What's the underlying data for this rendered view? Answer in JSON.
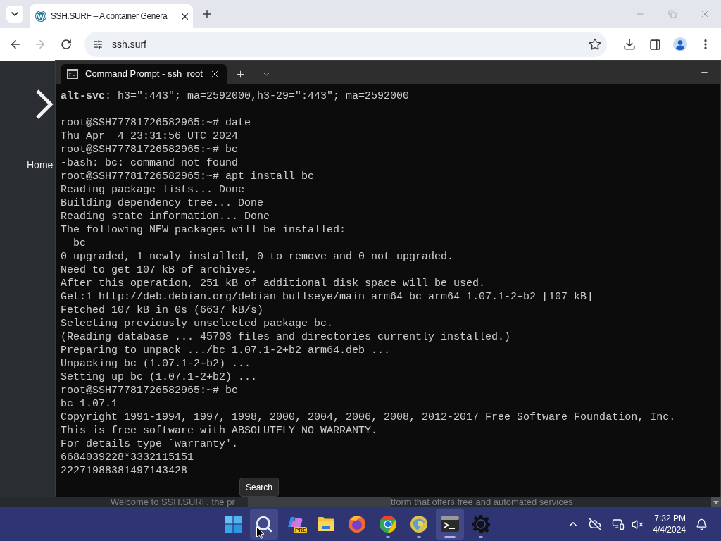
{
  "browser": {
    "tabs": [
      {
        "title": "SSH.SURF – A container Genera",
        "selected": true
      }
    ],
    "nav": {
      "back_disabled": false,
      "forward_disabled": true
    },
    "address": "ssh.surf"
  },
  "page": {
    "nav_label": "Home",
    "footer_texts": [
      "Welcome to SSH.SURF, the pr",
      "tform that offers free and automated services"
    ]
  },
  "terminal": {
    "tabs": [
      {
        "title": "Command Prompt - ssh  root",
        "selected": true
      }
    ],
    "lines": [
      {
        "kind": "output",
        "text": "**alt-svc**: h3=\":443\"; ma=2592000,h3-29=\":443\"; ma=2592000"
      },
      {
        "kind": "blank"
      },
      {
        "kind": "output",
        "text": "root@SSH77781726582965:~# date"
      },
      {
        "kind": "output",
        "text": "Thu Apr  4 23:31:56 UTC 2024"
      },
      {
        "kind": "output",
        "text": "root@SSH77781726582965:~# bc"
      },
      {
        "kind": "output",
        "text": "-bash: bc: command not found"
      },
      {
        "kind": "output",
        "text": "root@SSH77781726582965:~# apt install bc"
      },
      {
        "kind": "output",
        "text": "Reading package lists... Done"
      },
      {
        "kind": "output",
        "text": "Building dependency tree... Done"
      },
      {
        "kind": "output",
        "text": "Reading state information... Done"
      },
      {
        "kind": "output",
        "text": "The following NEW packages will be installed:"
      },
      {
        "kind": "output",
        "text": "  bc"
      },
      {
        "kind": "output",
        "text": "0 upgraded, 1 newly installed, 0 to remove and 0 not upgraded."
      },
      {
        "kind": "output",
        "text": "Need to get 107 kB of archives."
      },
      {
        "kind": "output",
        "text": "After this operation, 251 kB of additional disk space will be used."
      },
      {
        "kind": "output",
        "text": "Get:1 http://deb.debian.org/debian bullseye/main arm64 bc arm64 1.07.1-2+b2 [107 kB]"
      },
      {
        "kind": "output",
        "text": "Fetched 107 kB in 0s (6637 kB/s)"
      },
      {
        "kind": "output",
        "text": "Selecting previously unselected package bc."
      },
      {
        "kind": "output",
        "text": "(Reading database ... 45703 files and directories currently installed.)"
      },
      {
        "kind": "output",
        "text": "Preparing to unpack .../bc_1.07.1-2+b2_arm64.deb ..."
      },
      {
        "kind": "output",
        "text": "Unpacking bc (1.07.1-2+b2) ..."
      },
      {
        "kind": "output",
        "text": "Setting up bc (1.07.1-2+b2) ..."
      },
      {
        "kind": "output",
        "text": "root@SSH77781726582965:~# bc"
      },
      {
        "kind": "output",
        "text": "bc 1.07.1"
      },
      {
        "kind": "output",
        "text": "Copyright 1991-1994, 1997, 1998, 2000, 2004, 2006, 2008, 2012-2017 Free Software Foundation, Inc."
      },
      {
        "kind": "output",
        "text": "This is free software with ABSOLUTELY NO WARRANTY."
      },
      {
        "kind": "output",
        "text": "For details type `warranty'."
      },
      {
        "kind": "output",
        "text": "6684039228*3332115151"
      },
      {
        "kind": "output",
        "text": "22271988381497143428"
      }
    ]
  },
  "tooltip": "Search",
  "taskbar": {
    "apps": [
      {
        "kind": "start",
        "highlighted": false,
        "running": false,
        "active": false
      },
      {
        "kind": "search",
        "highlighted": true,
        "running": false,
        "active": false
      },
      {
        "kind": "copilot",
        "badge": "PRE",
        "highlighted": false,
        "running": false,
        "active": false
      },
      {
        "kind": "explorer",
        "highlighted": false,
        "running": false,
        "active": false
      },
      {
        "kind": "firefox",
        "highlighted": false,
        "running": false,
        "active": false
      },
      {
        "kind": "chrome",
        "highlighted": false,
        "running": true,
        "active": false
      },
      {
        "kind": "browser",
        "highlighted": false,
        "running": true,
        "active": false
      },
      {
        "kind": "terminal",
        "highlighted": true,
        "running": true,
        "active": true
      },
      {
        "kind": "settings",
        "highlighted": false,
        "running": true,
        "active": false
      }
    ],
    "clock": {
      "time": "7:32 PM",
      "date": "4/4/2024"
    }
  }
}
